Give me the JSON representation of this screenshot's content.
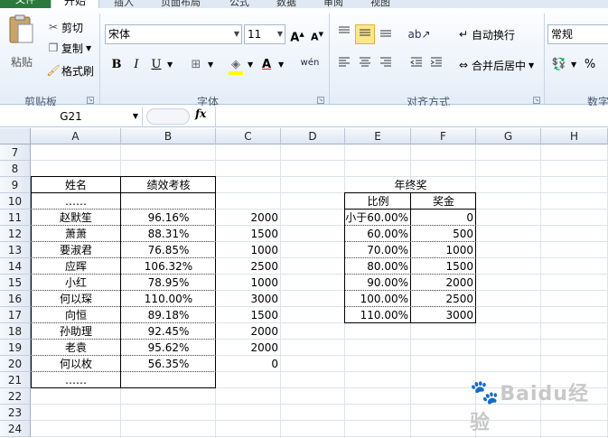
{
  "ribbon": {
    "tabs": {
      "file": "文件",
      "home": "开始",
      "insert": "插入",
      "layout": "页面布局",
      "formulas": "公式",
      "data": "数据",
      "review": "审阅",
      "view": "视图"
    },
    "clipboard": {
      "paste": "粘贴",
      "cut": "剪切",
      "copy": "复制",
      "format_painter": "格式刷",
      "label": "剪贴板"
    },
    "font": {
      "name": "宋体",
      "size": "11",
      "grow": "A",
      "shrink": "A",
      "bold": "B",
      "italic": "I",
      "underline": "U",
      "font_color": "A",
      "phonetic": "wén",
      "label": "字体"
    },
    "alignment": {
      "wrap": "自动换行",
      "merge": "合并后居中",
      "label": "对齐方式"
    },
    "number": {
      "format": "常规",
      "percent": "%",
      "label": "数字"
    }
  },
  "formula_bar": {
    "cell_ref": "G21",
    "fx": "fx",
    "content": ""
  },
  "columns": [
    "A",
    "B",
    "C",
    "D",
    "E",
    "F",
    "G",
    "H"
  ],
  "rows": [
    "7",
    "8",
    "9",
    "10",
    "11",
    "12",
    "13",
    "14",
    "15",
    "16",
    "17",
    "18",
    "19",
    "20",
    "21",
    "22",
    "23",
    "24"
  ],
  "table1": {
    "header": {
      "name": "姓名",
      "score": "绩效考核"
    },
    "rows": [
      {
        "name": "……",
        "score": "",
        "bonus": ""
      },
      {
        "name": "赵默笙",
        "score": "96.16%",
        "bonus": "2000"
      },
      {
        "name": "萧萧",
        "score": "88.31%",
        "bonus": "1500"
      },
      {
        "name": "要淑君",
        "score": "76.85%",
        "bonus": "1000"
      },
      {
        "name": "应晖",
        "score": "106.32%",
        "bonus": "2500"
      },
      {
        "name": "小红",
        "score": "78.95%",
        "bonus": "1000"
      },
      {
        "name": "何以琛",
        "score": "110.00%",
        "bonus": "3000"
      },
      {
        "name": "向恒",
        "score": "89.18%",
        "bonus": "1500"
      },
      {
        "name": "孙助理",
        "score": "92.45%",
        "bonus": "2000"
      },
      {
        "name": "老袁",
        "score": "95.62%",
        "bonus": "2000"
      },
      {
        "name": "何以枚",
        "score": "56.35%",
        "bonus": "0"
      },
      {
        "name": "……",
        "score": "",
        "bonus": ""
      }
    ]
  },
  "table2": {
    "title": "年终奖",
    "header": {
      "ratio": "比例",
      "bonus": "奖金"
    },
    "rows": [
      {
        "ratio": "小于60.00%",
        "bonus": "0"
      },
      {
        "ratio": "60.00%",
        "bonus": "500"
      },
      {
        "ratio": "70.00%",
        "bonus": "1000"
      },
      {
        "ratio": "80.00%",
        "bonus": "1500"
      },
      {
        "ratio": "90.00%",
        "bonus": "2000"
      },
      {
        "ratio": "100.00%",
        "bonus": "2500"
      },
      {
        "ratio": "110.00%",
        "bonus": "3000"
      }
    ]
  },
  "watermark": "Baidu经验"
}
